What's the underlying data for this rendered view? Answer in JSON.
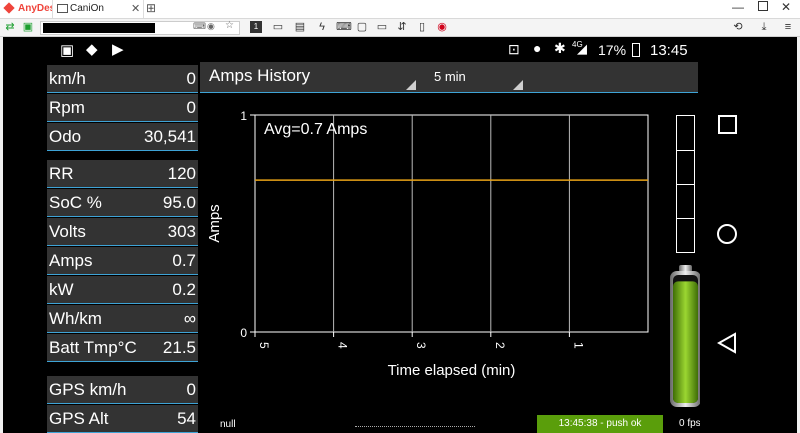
{
  "app": {
    "tabs": [
      {
        "label": "AnyDesk",
        "accent": "#ef443b"
      },
      {
        "label": "CaniOn"
      }
    ],
    "window_controls": [
      "minimize-icon",
      "maximize-icon",
      "close-icon"
    ]
  },
  "status_bar": {
    "battery": "17%",
    "time": "13:45",
    "network": "4G"
  },
  "left_panel": {
    "rows": [
      {
        "label": "km/h",
        "value": "0"
      },
      {
        "label": "Rpm",
        "value": "0"
      },
      {
        "label": "Odo",
        "value": "30,541"
      },
      {
        "label": "RR",
        "value": "120"
      },
      {
        "label": "SoC %",
        "value": "95.0"
      },
      {
        "label": "Volts",
        "value": "303"
      },
      {
        "label": "Amps",
        "value": "0.7"
      },
      {
        "label": "kW",
        "value": "0.2"
      },
      {
        "label": "Wh/km",
        "value": "∞"
      },
      {
        "label": "Batt Tmp°C",
        "value": "21.5"
      },
      {
        "label": "GPS km/h",
        "value": "0"
      },
      {
        "label": "GPS Alt",
        "value": "54"
      }
    ]
  },
  "header": {
    "title": "Amps History",
    "time_span": "5 min"
  },
  "chart_data": {
    "type": "line",
    "annotation": "Avg=0.7 Amps",
    "xlabel": "Time elapsed (min)",
    "ylabel": "Amps",
    "x_ticks": [
      "5",
      "4",
      "3",
      "2",
      "1"
    ],
    "y_ticks": [
      "1",
      "0"
    ],
    "ylim": [
      0,
      1
    ],
    "xlim": [
      5,
      0
    ],
    "grid": true,
    "series": [
      {
        "color": "#e8a317",
        "x": [
          5,
          0
        ],
        "y": [
          0.7,
          0.7
        ]
      }
    ]
  },
  "footer": {
    "left_text": "null",
    "push_status": "13:45:38 - push ok",
    "fps": "0 fps"
  },
  "colors": {
    "accent_line": "#3ea3d6",
    "panel_bg": "#333333",
    "battery_fill": "#7fbf1e"
  },
  "battery_level": 0.95
}
